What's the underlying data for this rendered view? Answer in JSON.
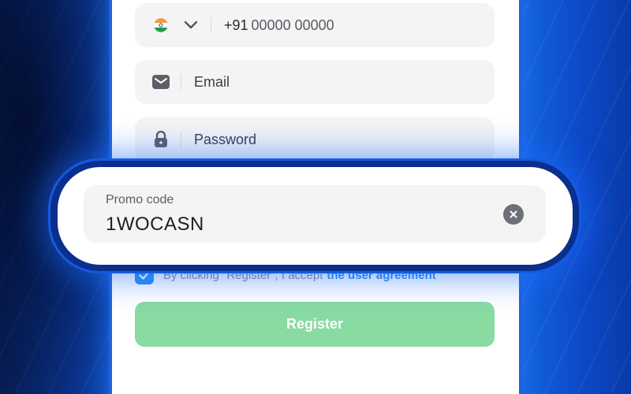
{
  "form": {
    "phone": {
      "country_icon": "india-flag-icon",
      "prefix": "+91",
      "placeholder": "00000 00000"
    },
    "email": {
      "icon": "mail-icon",
      "placeholder": "Email"
    },
    "password": {
      "icon": "lock-icon",
      "placeholder": "Password"
    },
    "promo": {
      "label": "Promo code",
      "value": "1WOCASN",
      "clear_icon": "close-icon"
    },
    "consent": {
      "checked": true,
      "text": "By clicking \"Register\", I accept",
      "link_text": "the user agreement"
    },
    "register_label": "Register"
  },
  "colors": {
    "accent_blue": "#2f8ef0",
    "register_green": "#88dba1",
    "field_bg": "#f4f4f5",
    "background_blue": "#1565e0"
  }
}
